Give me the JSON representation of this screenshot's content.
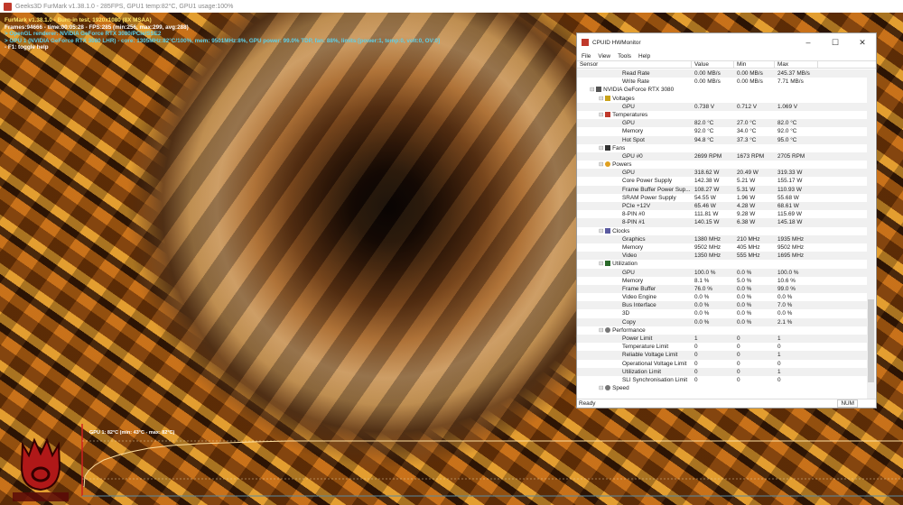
{
  "furmark": {
    "window_title": "Geeks3D FurMark v1.38.1.0 - 285FPS, GPU1 temp:82°C, GPU1 usage:100%",
    "overlay": [
      "FurMark v1.38.1.0 - Burn-in test, 1920x1080 (8X MSAA)",
      "Frames:94666 - time:00:05:28 - FPS:285 (min:256, max:299, avg:288)",
      "> OpenGL renderer: NVIDIA GeForce RTX 3080/PCIe/SSE2",
      "> GPU 1 (NVIDIA GeForce RTX 3080 LHR) - core: 1305MHz:82°C/100%, mem: 9501MHz:8%, GPU power: 99.0% TDP, fan: 88%, limits:[power:1, temp:0, volt:0, OV:0]",
      "- F1: toggle help"
    ],
    "graph_label": "GPU 1: 82°C (min: 43°C - max: 82°C)",
    "logo_text": "FurMark"
  },
  "hwmonitor": {
    "title": "CPUID HWMonitor",
    "menu": [
      "File",
      "View",
      "Tools",
      "Help"
    ],
    "columns": [
      "Sensor",
      "Value",
      "Min",
      "Max"
    ],
    "rows": [
      {
        "lvl": 3,
        "label": "Read Rate",
        "v": "0.00 MB/s",
        "min": "0.00 MB/s",
        "max": "245.37 MB/s"
      },
      {
        "lvl": 3,
        "label": "Write Rate",
        "v": "0.00 MB/s",
        "min": "0.00 MB/s",
        "max": "7.71 MB/s"
      },
      {
        "lvl": 1,
        "label": "NVIDIA GeForce RTX 3080",
        "icon": "gpu"
      },
      {
        "lvl": 2,
        "label": "Voltages",
        "icon": "voltage"
      },
      {
        "lvl": 3,
        "label": "GPU",
        "v": "0.738 V",
        "min": "0.712 V",
        "max": "1.069 V"
      },
      {
        "lvl": 2,
        "label": "Temperatures",
        "icon": "thermometer"
      },
      {
        "lvl": 3,
        "label": "GPU",
        "v": "82.0 °C",
        "min": "27.0 °C",
        "max": "82.0 °C"
      },
      {
        "lvl": 3,
        "label": "Memory",
        "v": "92.0 °C",
        "min": "34.0 °C",
        "max": "92.0 °C"
      },
      {
        "lvl": 3,
        "label": "Hot Spot",
        "v": "94.8 °C",
        "min": "37.3 °C",
        "max": "95.0 °C"
      },
      {
        "lvl": 2,
        "label": "Fans",
        "icon": "fan"
      },
      {
        "lvl": 3,
        "label": "GPU #0",
        "v": "2699 RPM",
        "min": "1673 RPM",
        "max": "2705 RPM"
      },
      {
        "lvl": 2,
        "label": "Powers",
        "icon": "power"
      },
      {
        "lvl": 3,
        "label": "GPU",
        "v": "318.62 W",
        "min": "20.49 W",
        "max": "319.33 W"
      },
      {
        "lvl": 3,
        "label": "Core Power Supply",
        "v": "142.38 W",
        "min": "5.21 W",
        "max": "155.17 W"
      },
      {
        "lvl": 3,
        "label": "Frame Buffer Power Sup...",
        "v": "108.27 W",
        "min": "5.31 W",
        "max": "110.93 W"
      },
      {
        "lvl": 3,
        "label": "SRAM Power Supply",
        "v": "54.55 W",
        "min": "1.96 W",
        "max": "55.68 W"
      },
      {
        "lvl": 3,
        "label": "PCIe +12V",
        "v": "65.46 W",
        "min": "4.28 W",
        "max": "68.61 W"
      },
      {
        "lvl": 3,
        "label": "8-PIN #0",
        "v": "111.81 W",
        "min": "9.28 W",
        "max": "115.69 W"
      },
      {
        "lvl": 3,
        "label": "8-PIN #1",
        "v": "140.15 W",
        "min": "6.38 W",
        "max": "145.18 W"
      },
      {
        "lvl": 2,
        "label": "Clocks",
        "icon": "clock"
      },
      {
        "lvl": 3,
        "label": "Graphics",
        "v": "1380 MHz",
        "min": "210 MHz",
        "max": "1935 MHz"
      },
      {
        "lvl": 3,
        "label": "Memory",
        "v": "9502 MHz",
        "min": "405 MHz",
        "max": "9502 MHz"
      },
      {
        "lvl": 3,
        "label": "Video",
        "v": "1350 MHz",
        "min": "555 MHz",
        "max": "1695 MHz"
      },
      {
        "lvl": 2,
        "label": "Utilization",
        "icon": "utilization"
      },
      {
        "lvl": 3,
        "label": "GPU",
        "v": "100.0 %",
        "min": "0.0 %",
        "max": "100.0 %"
      },
      {
        "lvl": 3,
        "label": "Memory",
        "v": "8.1 %",
        "min": "5.0 %",
        "max": "10.6 %"
      },
      {
        "lvl": 3,
        "label": "Frame Buffer",
        "v": "76.0 %",
        "min": "0.0 %",
        "max": "99.0 %"
      },
      {
        "lvl": 3,
        "label": "Video Engine",
        "v": "0.0 %",
        "min": "0.0 %",
        "max": "0.0 %"
      },
      {
        "lvl": 3,
        "label": "Bus Interface",
        "v": "0.0 %",
        "min": "0.0 %",
        "max": "7.0 %"
      },
      {
        "lvl": 3,
        "label": "3D",
        "v": "0.0 %",
        "min": "0.0 %",
        "max": "0.0 %"
      },
      {
        "lvl": 3,
        "label": "Copy",
        "v": "0.0 %",
        "min": "0.0 %",
        "max": "2.1 %"
      },
      {
        "lvl": 2,
        "label": "Performance",
        "icon": "performance"
      },
      {
        "lvl": 3,
        "label": "Power Limit",
        "v": "1",
        "min": "0",
        "max": "1"
      },
      {
        "lvl": 3,
        "label": "Temperature Limit",
        "v": "0",
        "min": "0",
        "max": "0"
      },
      {
        "lvl": 3,
        "label": "Reliable Voltage Limit",
        "v": "0",
        "min": "0",
        "max": "1"
      },
      {
        "lvl": 3,
        "label": "Operational Voltage Limit",
        "v": "0",
        "min": "0",
        "max": "0"
      },
      {
        "lvl": 3,
        "label": "Utilization Limit",
        "v": "0",
        "min": "0",
        "max": "1"
      },
      {
        "lvl": 3,
        "label": "SLI Synchronisation Limit",
        "v": "0",
        "min": "0",
        "max": "0"
      },
      {
        "lvl": 2,
        "label": "Speed",
        "icon": "speed"
      }
    ],
    "status": "Ready",
    "num_indicator": "NUM",
    "colors": {
      "gpu": "#555",
      "voltage": "#c9a21a",
      "thermometer": "#c0392b",
      "fan": "#333",
      "power": "#e0a020",
      "clock": "#5a5aa0",
      "utilization": "#2a6a2a",
      "performance": "#777",
      "speed": "#777"
    }
  }
}
